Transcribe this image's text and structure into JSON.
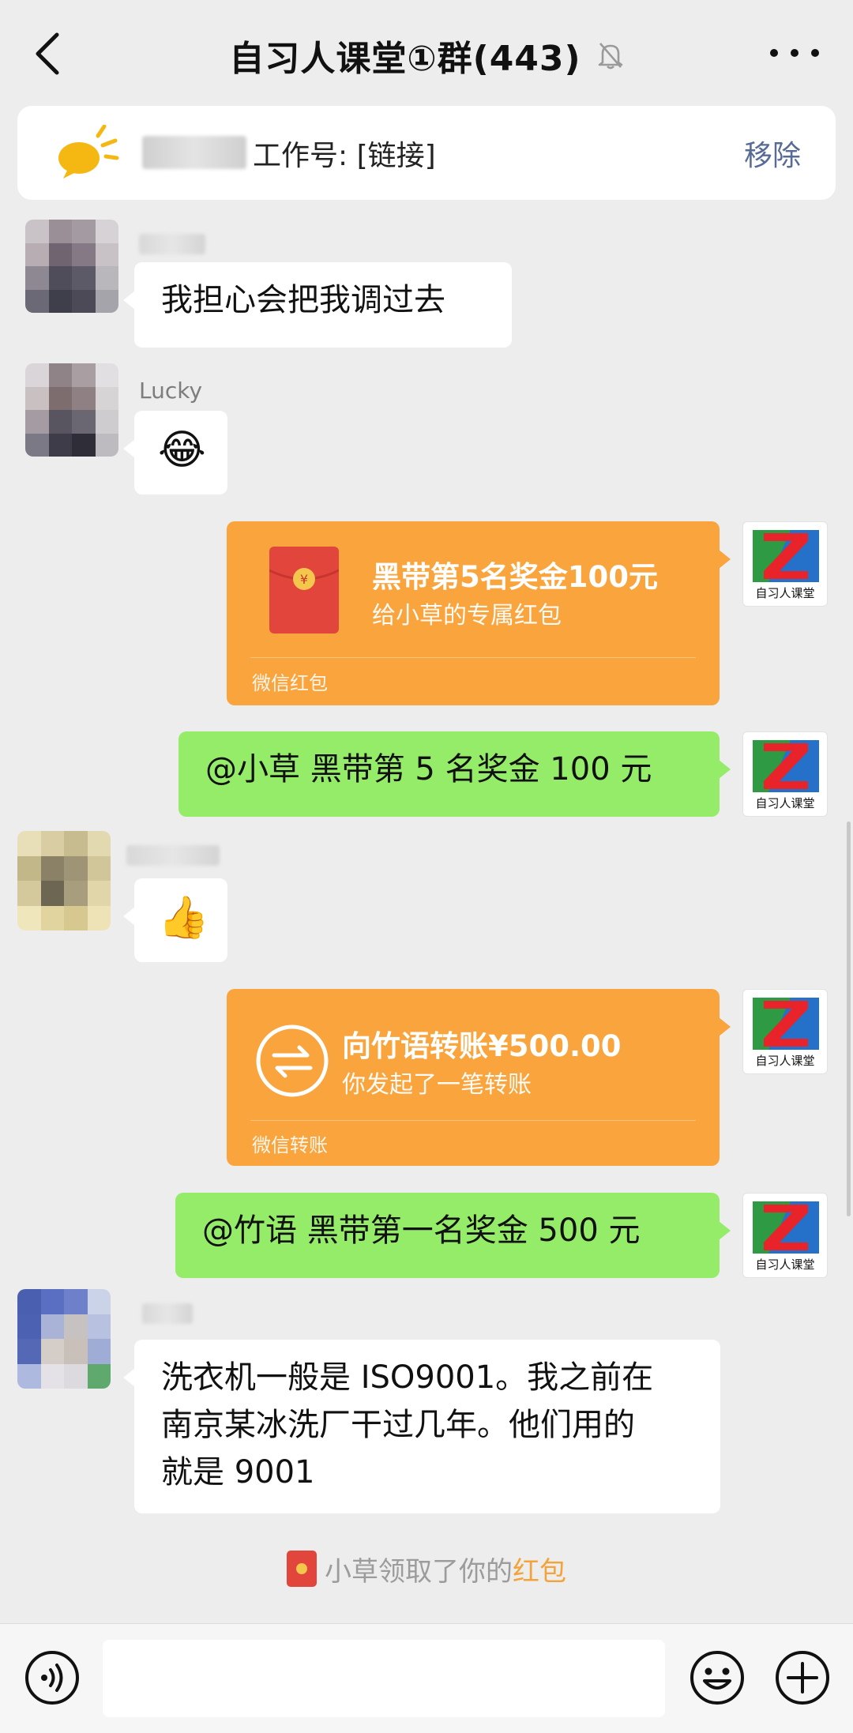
{
  "header": {
    "title": "自习人课堂①群(443)",
    "back_icon": "chevron-left-icon",
    "muted_icon": "bell-off-icon",
    "more_icon": "more-horizontal-icon"
  },
  "notice": {
    "icon": "bulb-icon",
    "text": "工作号: [链接]",
    "remove_label": "移除"
  },
  "messages": [
    {
      "side": "left",
      "type": "text",
      "sender": "",
      "text": "我担心会把我调过去"
    },
    {
      "side": "left",
      "type": "emoji",
      "sender": "Lucky",
      "emoji": "😂"
    },
    {
      "side": "right",
      "type": "red_packet",
      "title": "黑带第5名奖金100元",
      "subtitle": "给小草的专属红包",
      "footer": "微信红包"
    },
    {
      "side": "right",
      "type": "text",
      "text": "@小草  黑带第 5 名奖金 100 元"
    },
    {
      "side": "left",
      "type": "emoji",
      "sender": "",
      "emoji": "👍"
    },
    {
      "side": "right",
      "type": "transfer",
      "title": "向竹语转账¥500.00",
      "subtitle": "你发起了一笔转账",
      "footer": "微信转账"
    },
    {
      "side": "right",
      "type": "text",
      "text": "@竹语  黑带第一名奖金 500 元"
    },
    {
      "side": "left",
      "type": "text",
      "sender": "",
      "lines": [
        "洗衣机一般是 ISO9001。我之前在",
        "南京某冰洗厂干过几年。他们用的",
        "就是 9001"
      ]
    }
  ],
  "self_avatar_label": "自习人课堂",
  "system_note": {
    "prefix": "小草领取了你的",
    "highlight": "红包"
  },
  "bottom_bar": {
    "voice_icon": "voice-icon",
    "emoji_icon": "smile-icon",
    "plus_icon": "plus-circle-icon"
  },
  "colors": {
    "background": "#ededed",
    "green_bubble": "#95ec69",
    "orange_card": "#f9a43c",
    "link_blue": "#576b95"
  }
}
